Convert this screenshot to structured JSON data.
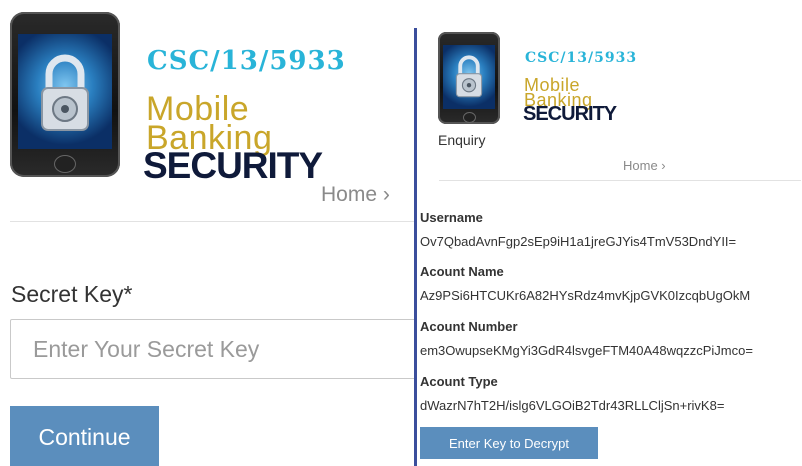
{
  "left": {
    "logo": {
      "csc": "CSC/13/5933",
      "line1": "Mobile",
      "line2": "Banking",
      "security": "SECURITY"
    },
    "breadcrumb_home": "Home ›",
    "secret_key_label": "Secret Key*",
    "secret_key_placeholder": "Enter Your Secret Key",
    "continue_label": "Continue"
  },
  "right": {
    "logo": {
      "csc": "CSC/13/5933",
      "line1": "Mobile",
      "line2": "Banking",
      "security": "SECURITY"
    },
    "enquiry_label": "Enquiry",
    "breadcrumb_home": "Home ›",
    "fields": {
      "username": {
        "label": "Username",
        "value": "Ov7QbadAvnFgp2sEp9iH1a1jreGJYis4TmV53DndYII="
      },
      "account_name": {
        "label": "Acount Name",
        "value": "Az9PSi6HTCUKr6A82HYsRdz4mvKjpGVK0IzcqbUgOkM"
      },
      "account_number": {
        "label": "Acount Number",
        "value": "em3OwupseKMgYi3GdR4lsvgeFTM40A48wqzzcPiJmco="
      },
      "account_type": {
        "label": "Acount Type",
        "value": "dWazrN7hT2H/islg6VLGOiB2Tdr43RLLCljSn+rivK8="
      }
    },
    "decrypt_label": "Enter Key to Decrypt"
  },
  "colors": {
    "button": "#5b8ebd",
    "divider": "#3b4e9c",
    "csc": "#29b4d8",
    "mobile_banking": "#c9a62a",
    "security": "#0f1a3a"
  },
  "icons": {
    "logo_phone": "phone-padlock-icon"
  }
}
